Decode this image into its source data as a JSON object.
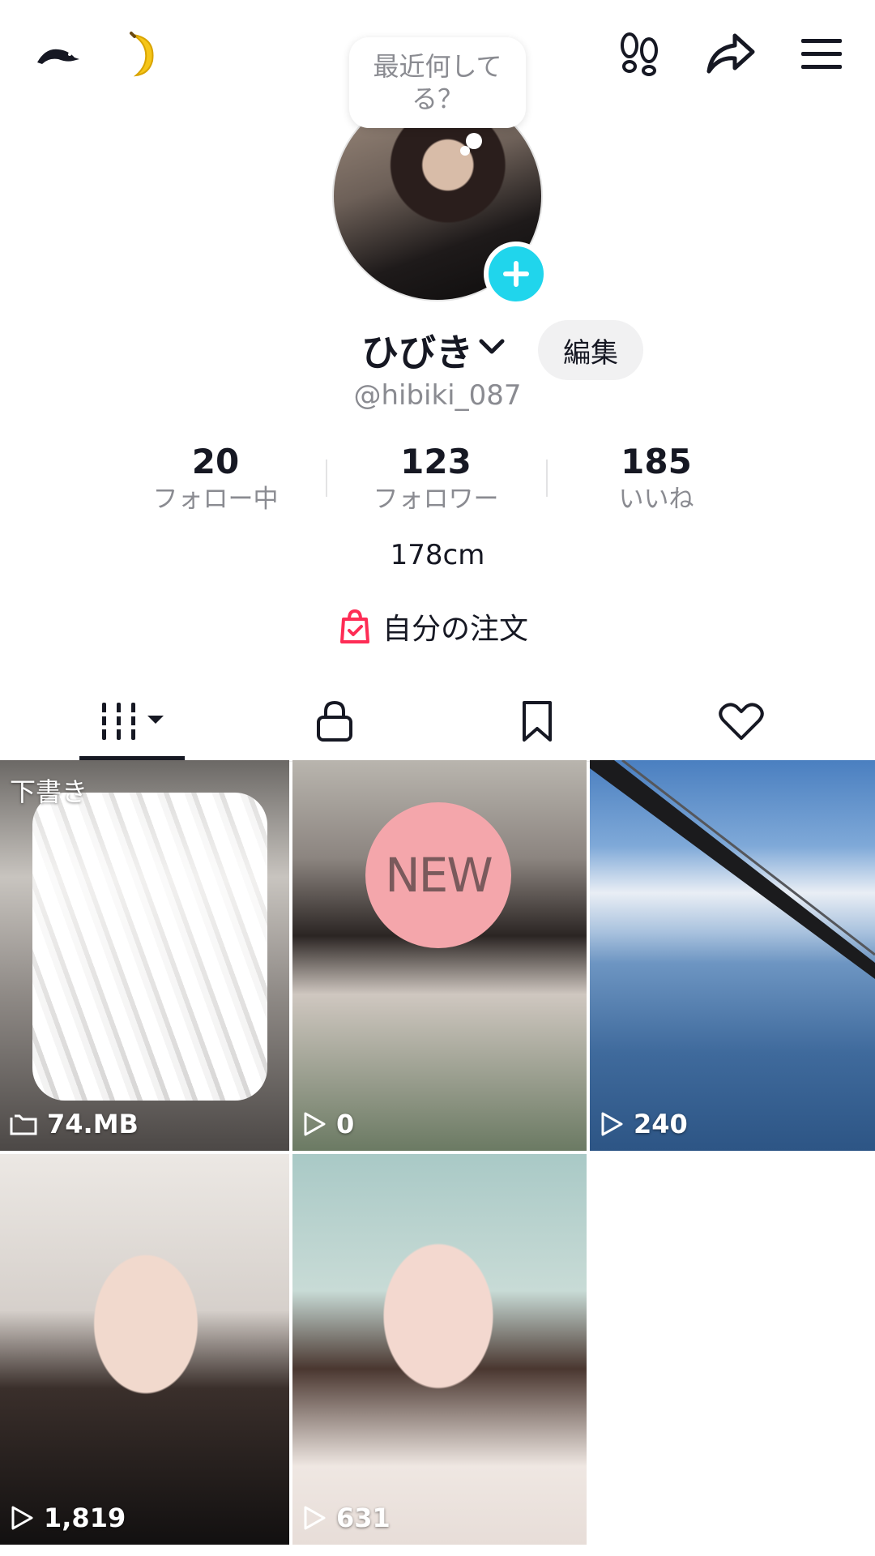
{
  "top_bar": {
    "left_icons": [
      "bird-icon",
      "banana-icon"
    ],
    "right_icons": [
      "footprints-icon",
      "share-icon",
      "menu-icon"
    ]
  },
  "profile": {
    "status_prompt": "最近何してる？",
    "name": "ひびき",
    "edit_label": "編集",
    "handle": "@hibiki_087",
    "accent_color": "#20d5ec"
  },
  "stats": [
    {
      "value": "20",
      "label": "フォロー中"
    },
    {
      "value": "123",
      "label": "フォロワー"
    },
    {
      "value": "185",
      "label": "いいね"
    }
  ],
  "bio": "178cm",
  "orders": {
    "label": "自分の注文",
    "icon": "shopping-bag-icon",
    "color": "#fe2c55"
  },
  "tabs": [
    {
      "name": "videos",
      "icon": "grid-icon",
      "active": true
    },
    {
      "name": "private",
      "icon": "lock-icon",
      "active": false
    },
    {
      "name": "saved",
      "icon": "bookmark-icon",
      "active": false
    },
    {
      "name": "liked",
      "icon": "heart-icon",
      "active": false
    }
  ],
  "videos": [
    {
      "type": "draft",
      "label": "下書き",
      "count": "74.MB",
      "count_icon": "folder-icon"
    },
    {
      "type": "video",
      "badge": "NEW",
      "count": "0",
      "count_icon": "play-icon"
    },
    {
      "type": "video",
      "count": "240",
      "count_icon": "play-icon"
    },
    {
      "type": "video",
      "count": "1,819",
      "count_icon": "play-icon"
    },
    {
      "type": "video",
      "count": "631",
      "count_icon": "play-icon"
    }
  ]
}
